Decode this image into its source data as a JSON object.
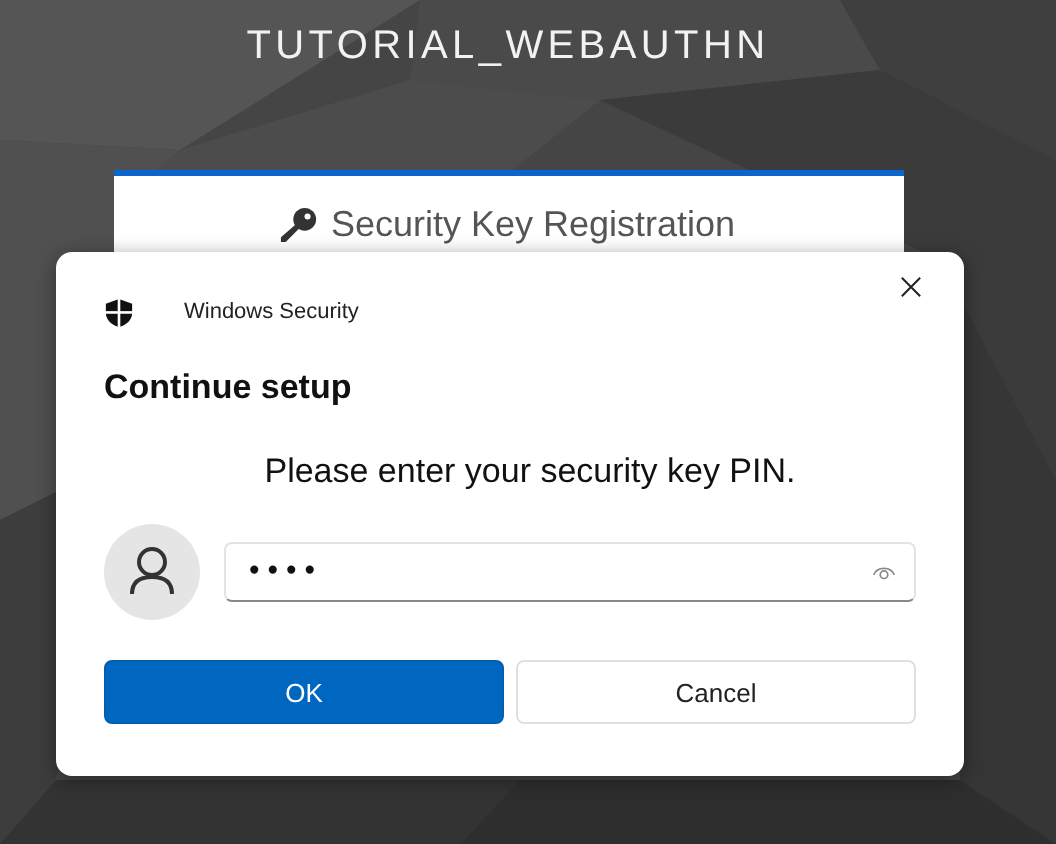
{
  "page": {
    "title": "TUTORIAL_WEBAUTHN"
  },
  "card": {
    "title": "Security Key Registration"
  },
  "dialog": {
    "app_name": "Windows Security",
    "heading": "Continue setup",
    "prompt": "Please enter your security key PIN.",
    "pin_field": {
      "value": "••••"
    },
    "buttons": [
      {
        "label": "OK",
        "kind": "primary"
      },
      {
        "label": "Cancel",
        "kind": "secondary"
      }
    ]
  }
}
